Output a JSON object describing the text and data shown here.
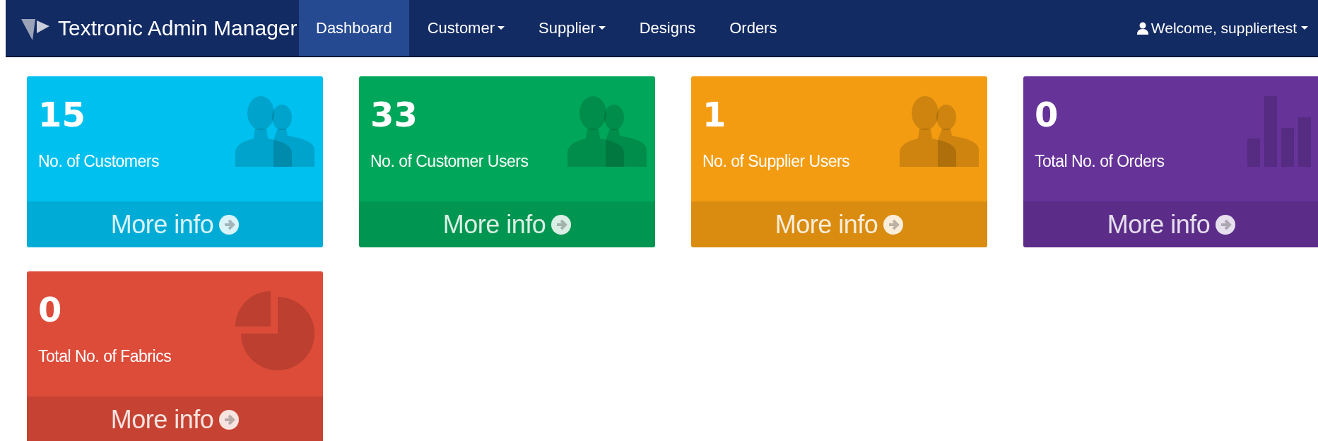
{
  "navbar": {
    "brand": "Textronic Admin Manager",
    "items": [
      {
        "label": "Dashboard",
        "selected": true,
        "dropdown": false
      },
      {
        "label": "Customer",
        "selected": false,
        "dropdown": true
      },
      {
        "label": "Supplier",
        "selected": false,
        "dropdown": true
      },
      {
        "label": "Designs",
        "selected": false,
        "dropdown": false
      },
      {
        "label": "Orders",
        "selected": false,
        "dropdown": false
      }
    ],
    "user": {
      "label": "Welcome, suppliertest",
      "dropdown": true
    }
  },
  "cards": [
    {
      "value": "15",
      "label": "No. of Customers",
      "color": "#00c0ef",
      "kind": "people",
      "link": "More info"
    },
    {
      "value": "33",
      "label": "No. of Customer Users",
      "color": "#00a65a",
      "kind": "people",
      "link": "More info"
    },
    {
      "value": "1",
      "label": "No. of Supplier Users",
      "color": "#f39c12",
      "kind": "people",
      "link": "More info"
    },
    {
      "value": "0",
      "label": "Total No. of Orders",
      "color": "#663399",
      "kind": "bars",
      "link": "More info"
    },
    {
      "value": "0",
      "label": "Total No. of Fabrics",
      "color": "#dd4b39",
      "kind": "pie",
      "link": "More info"
    }
  ]
}
